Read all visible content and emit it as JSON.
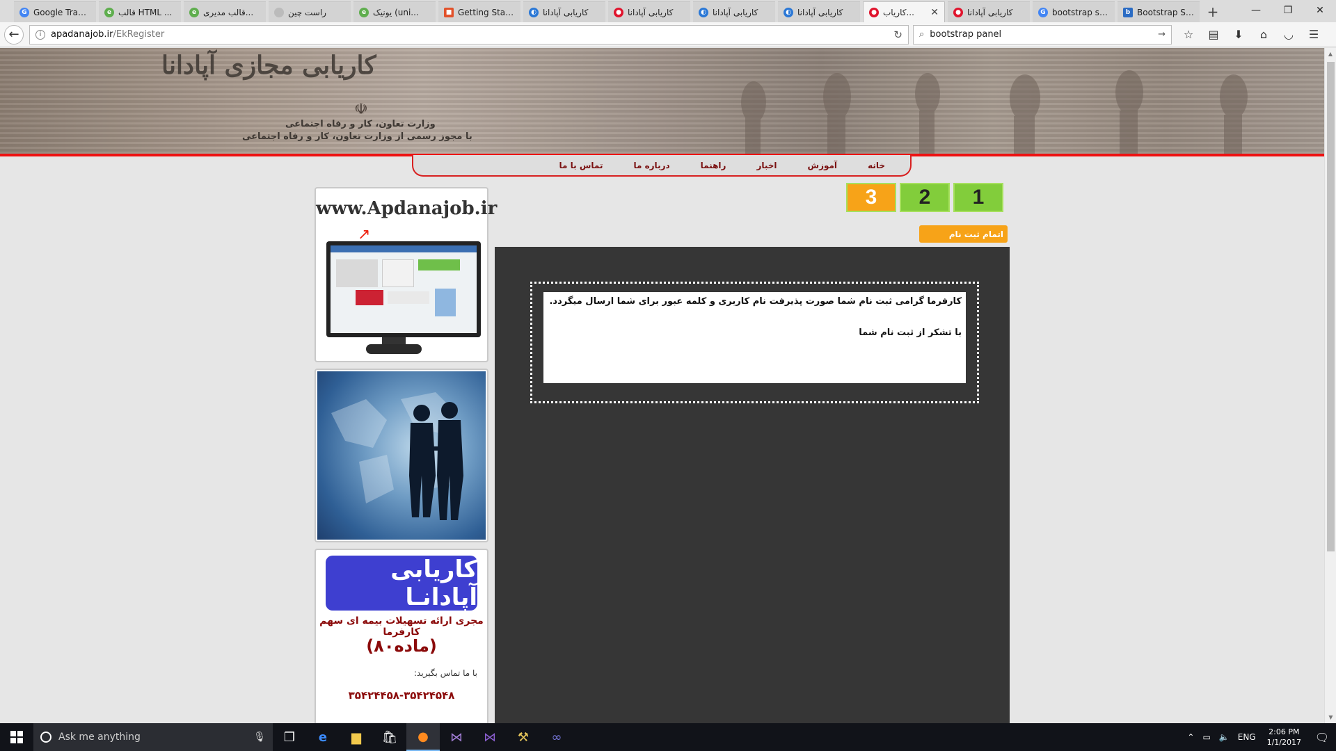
{
  "browser": {
    "tabs": [
      {
        "title": "Google Trans...",
        "color": "#4285f4",
        "active": false
      },
      {
        "title": "قالب HTML ...",
        "color": "#5fae4e",
        "active": false
      },
      {
        "title": "قالب مدیری...",
        "color": "#5fae4e",
        "active": false
      },
      {
        "title": "راست چین",
        "color": "#999999",
        "active": false
      },
      {
        "title": "یونیک (uni...",
        "color": "#5fae4e",
        "active": false
      },
      {
        "title": "Getting Starte...",
        "color": "#e2522b",
        "active": false
      },
      {
        "title": "کاریابی آپادانا",
        "color": "#2b78d6",
        "active": false
      },
      {
        "title": "کاریابی آپادانا",
        "color": "#e0142d",
        "active": false
      },
      {
        "title": "کاریابی آپادانا",
        "color": "#2b78d6",
        "active": false
      },
      {
        "title": "کاریابی آپادانا",
        "color": "#2b78d6",
        "active": false
      },
      {
        "title": "کاریاب...",
        "color": "#e0142d",
        "active": true
      },
      {
        "title": "کاریابی آپادانا",
        "color": "#e0142d",
        "active": false
      },
      {
        "title": "bootstrap ste...",
        "color": "#4285f4",
        "active": false
      },
      {
        "title": "Bootstrap Sni...",
        "color": "#2b6cc4",
        "active": false
      }
    ],
    "url_domain": "apadanajob.ir",
    "url_path": "/EkRegister",
    "search_value": "bootstrap panel"
  },
  "banner": {
    "title": "کاریابی مجازی آپادانا",
    "emblem": "☫",
    "subtitle1": "وزارت تعاون، کار و رفاه اجتماعی",
    "subtitle2": "با مجوز رسمی از وزارت تعاون، کار و رفاه اجتماعی"
  },
  "menu": {
    "items": [
      "خانه",
      "آموزش",
      "اخبار",
      "راهنما",
      "درباره ما",
      "تماس با ما"
    ]
  },
  "steps": {
    "s1": "1",
    "s2": "2",
    "s3": "3"
  },
  "finish_badge": "اتمام ثبت نام",
  "message": {
    "line1": "کارفرما گرامی ثبت نام شما صورت پذیرفت نام کاربری و کلمه عبور برای شما ارسال میگردد.",
    "line2": "با تشکر از ثبت نام شما"
  },
  "sidebar": {
    "site_title": "www.Apdanajob.ir",
    "ins_logo": "کاریابی آپادانـا",
    "ins_line1": "مجری ارائه تسهیلات بیمه ای سهم کارفرما",
    "ins_line2": "(ماده۸۰)",
    "ins_line3": "با ما تماس بگیرید:",
    "ins_line4": "۳۵۴۲۴۴۵۸-۳۵۴۲۴۵۴۸"
  },
  "taskbar": {
    "search_placeholder": "Ask me anything",
    "lang": "ENG",
    "time": "2:06 PM",
    "date": "1/1/2017"
  }
}
